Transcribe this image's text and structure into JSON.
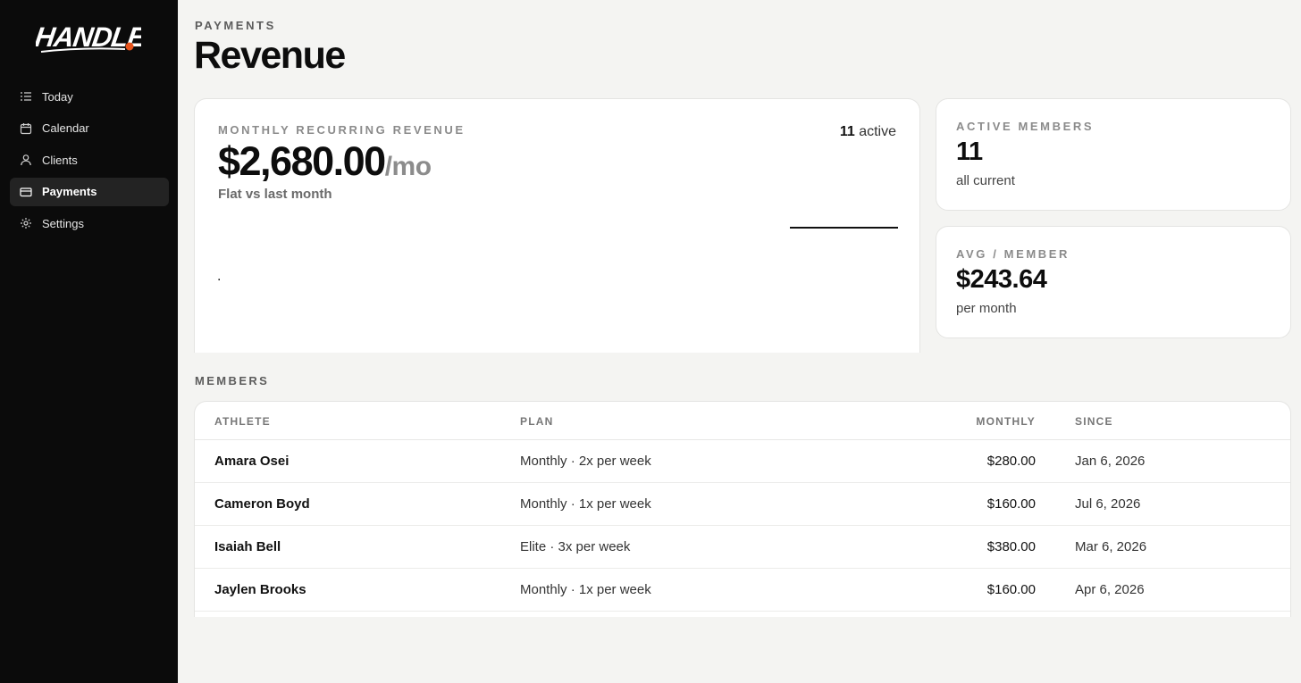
{
  "brand": {
    "name": "HANDLES",
    "accent": "#e8541c"
  },
  "sidebar": {
    "items": [
      {
        "label": "Today",
        "icon": "list-icon",
        "active": false
      },
      {
        "label": "Calendar",
        "icon": "calendar-icon",
        "active": false
      },
      {
        "label": "Clients",
        "icon": "user-icon",
        "active": false
      },
      {
        "label": "Payments",
        "icon": "card-icon",
        "active": true
      },
      {
        "label": "Settings",
        "icon": "gear-icon",
        "active": false
      }
    ]
  },
  "header": {
    "eyebrow": "PAYMENTS",
    "title": "Revenue"
  },
  "mrr": {
    "eyebrow": "MONTHLY RECURRING REVENUE",
    "value": "$2,680.00",
    "unit": "/mo",
    "trend": "Flat vs last month",
    "active_count": "11",
    "active_label": "active",
    "dot": "."
  },
  "active_members": {
    "eyebrow": "ACTIVE MEMBERS",
    "value": "11",
    "sub": "all current"
  },
  "avg_member": {
    "eyebrow": "AVG / MEMBER",
    "value": "$243.64",
    "sub": "per month"
  },
  "members": {
    "section_label": "MEMBERS",
    "columns": {
      "athlete": "ATHLETE",
      "plan": "PLAN",
      "monthly": "MONTHLY",
      "since": "SINCE"
    },
    "rows": [
      {
        "athlete": "Amara Osei",
        "plan": "Monthly · 2x per week",
        "monthly": "$280.00",
        "since": "Jan 6, 2026"
      },
      {
        "athlete": "Cameron Boyd",
        "plan": "Monthly · 1x per week",
        "monthly": "$160.00",
        "since": "Jul 6, 2026"
      },
      {
        "athlete": "Isaiah Bell",
        "plan": "Elite · 3x per week",
        "monthly": "$380.00",
        "since": "Mar 6, 2026"
      },
      {
        "athlete": "Jaylen Brooks",
        "plan": "Monthly · 1x per week",
        "monthly": "$160.00",
        "since": "Apr 6, 2026"
      }
    ]
  }
}
